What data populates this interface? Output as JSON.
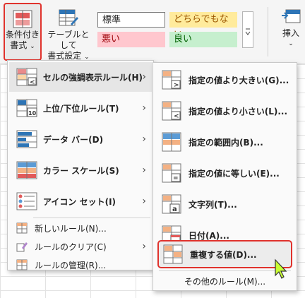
{
  "ribbon": {
    "conditional_format": {
      "line1": "条件付き",
      "line2": "書式",
      "caret": "⌄"
    },
    "format_as_table": {
      "line1": "テーブルとして",
      "line2": "書式設定",
      "caret": "⌄"
    },
    "styles": {
      "standard": "標準",
      "neutral": "どちらでもない",
      "bad": "悪い",
      "good": "良い"
    },
    "insert": {
      "label": "挿入",
      "caret": "⌄"
    }
  },
  "main_menu": {
    "items": [
      {
        "label": "セルの強調表示ルール(H)",
        "icon": "highlight-cells-icon"
      },
      {
        "label": "上位/下位ルール(T)",
        "icon": "top-bottom-icon"
      },
      {
        "label": "データ バー(D)",
        "icon": "data-bars-icon"
      },
      {
        "label": "カラー スケール(S)",
        "icon": "color-scales-icon"
      },
      {
        "label": "アイコン セット(I)",
        "icon": "icon-sets-icon"
      }
    ],
    "small_items": [
      {
        "label": "新しいルール(N)...",
        "icon": "new-rule-icon"
      },
      {
        "label": "ルールのクリア(C)",
        "icon": "clear-rules-icon"
      },
      {
        "label": "ルールの管理(R)...",
        "icon": "manage-rules-icon"
      }
    ],
    "arrow": "›"
  },
  "sub_menu": {
    "items": [
      {
        "label": "指定の値より大きい(G)...",
        "icon": "greater-than-icon"
      },
      {
        "label": "指定の値より小さい(L)...",
        "icon": "less-than-icon"
      },
      {
        "label": "指定の範囲内(B)...",
        "icon": "between-icon"
      },
      {
        "label": "指定の値に等しい(E)...",
        "icon": "equal-to-icon"
      },
      {
        "label": "文字列(T)...",
        "icon": "text-contains-icon"
      },
      {
        "label": "日付(A)...",
        "icon": "date-occurring-icon"
      },
      {
        "label": "重複する値(D)...",
        "icon": "duplicate-values-icon"
      }
    ],
    "other": "その他のルール(M)..."
  },
  "colors": {
    "highlight_border": "#e0322c",
    "accent_blue": "#2e75b6",
    "accent_red": "#e15a5a"
  }
}
